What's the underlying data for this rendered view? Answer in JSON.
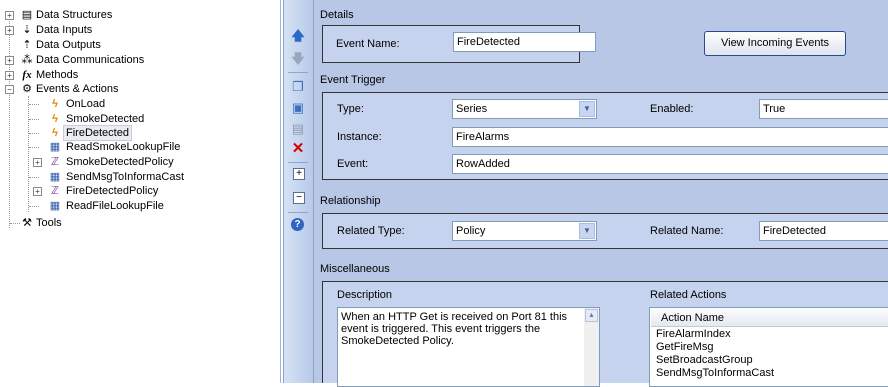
{
  "tree": {
    "items": [
      {
        "label": "Data Structures",
        "icon": "table-icon"
      },
      {
        "label": "Data Inputs",
        "icon": "data-input-icon"
      },
      {
        "label": "Data Outputs",
        "icon": "data-output-icon"
      },
      {
        "label": "Data Communications",
        "icon": "network-icon"
      },
      {
        "label": "Methods",
        "icon": "function-icon"
      },
      {
        "label": "Events & Actions",
        "icon": "events-icon"
      },
      {
        "label": "OnLoad",
        "icon": "lightning-icon"
      },
      {
        "label": "SmokeDetected",
        "icon": "lightning-icon"
      },
      {
        "label": "FireDetected",
        "icon": "lightning-icon"
      },
      {
        "label": "ReadSmokeLookupFile",
        "icon": "action-icon"
      },
      {
        "label": "SmokeDetectedPolicy",
        "icon": "policy-icon"
      },
      {
        "label": "SendMsgToInformaCast",
        "icon": "action-icon"
      },
      {
        "label": "FireDetectedPolicy",
        "icon": "policy-icon"
      },
      {
        "label": "ReadFileLookupFile",
        "icon": "action-icon"
      },
      {
        "label": "Tools",
        "icon": "tools-icon"
      }
    ]
  },
  "toolbar": {
    "buttons": [
      "move-up-icon",
      "move-down-icon",
      "copy-icon",
      "paste-icon",
      "properties-icon",
      "delete-icon",
      "expand-icon",
      "collapse-icon",
      "help-icon"
    ]
  },
  "details": {
    "header": "Details",
    "event_name_label": "Event Name:",
    "event_name_value": "FireDetected",
    "view_button": "View Incoming Events"
  },
  "trigger": {
    "header": "Event Trigger",
    "type_label": "Type:",
    "type_value": "Series",
    "enabled_label": "Enabled:",
    "enabled_value": "True",
    "instance_label": "Instance:",
    "instance_value": "FireAlarms",
    "event_label": "Event:",
    "event_value": "RowAdded"
  },
  "relationship": {
    "header": "Relationship",
    "related_type_label": "Related Type:",
    "related_type_value": "Policy",
    "related_name_label": "Related Name:",
    "related_name_value": "FireDetected"
  },
  "misc": {
    "header": "Miscellaneous",
    "description_label": "Description",
    "description_text": "When an HTTP Get is received on Port 81 this event is triggered.  This event triggers the SmokeDetected Policy.",
    "related_actions_label": "Related Actions",
    "actions_column": "Action Name",
    "actions": [
      "FireAlarmIndex",
      "GetFireMsg",
      "SetBroadcastGroup",
      "SendMsgToInformaCast"
    ]
  }
}
